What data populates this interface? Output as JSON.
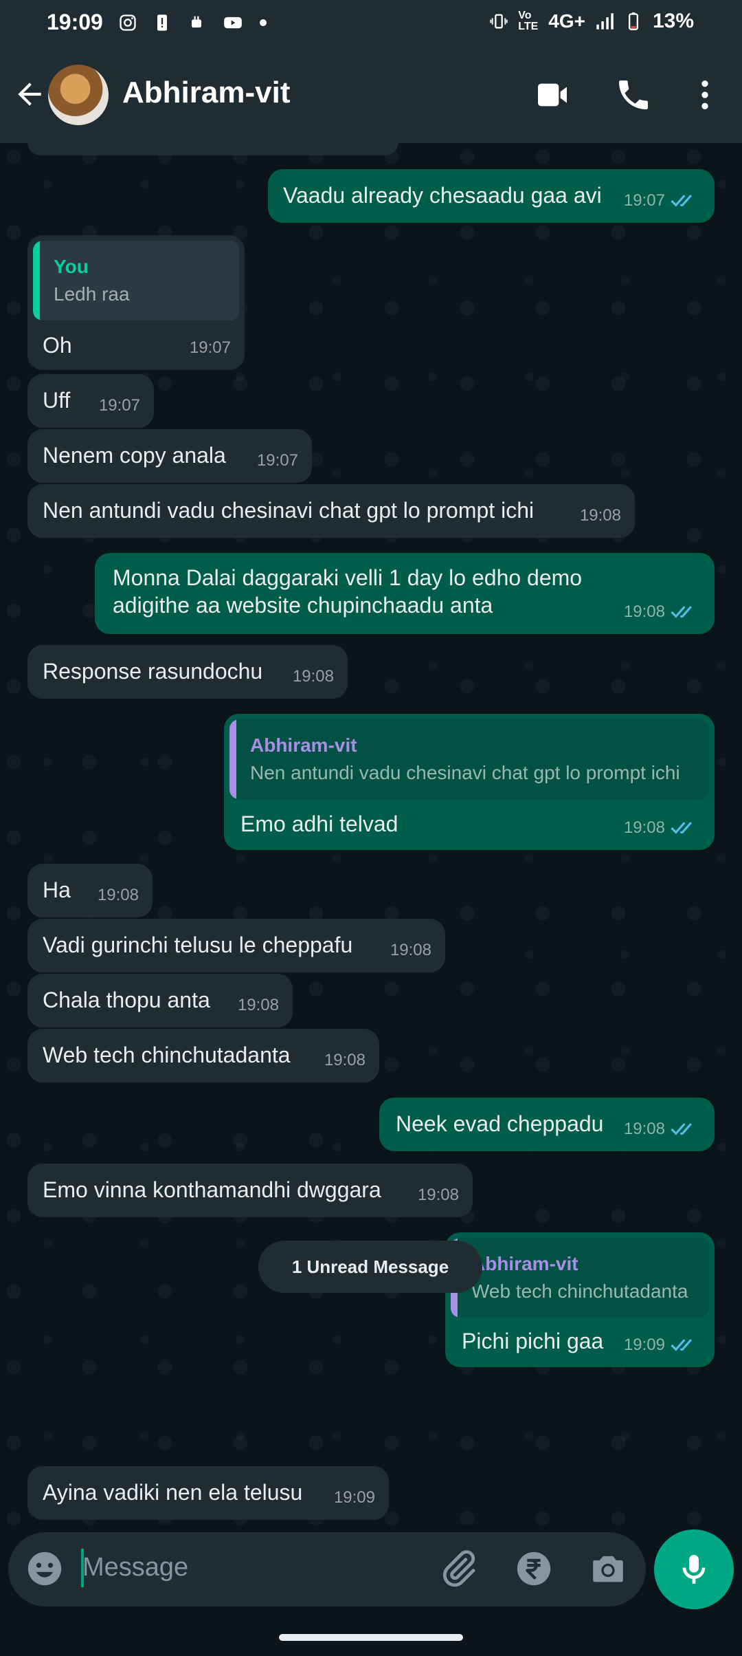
{
  "status_bar": {
    "time": "19:09",
    "network": "4G+",
    "volte": "Vo LTE",
    "battery": "13%"
  },
  "header": {
    "contact_name": "Abhiram-vit"
  },
  "colors": {
    "header_bg": "#1f2c34",
    "incoming_bubble": "#1f2c34",
    "outgoing_bubble": "#005c4b",
    "accent": "#00a884",
    "quote_you": "#06cf9c",
    "quote_contact": "#a98ee6"
  },
  "messages": [
    {
      "dir": "out",
      "text": "Vaadu already chesaadu gaa avi",
      "time": "19:07",
      "read": true
    },
    {
      "dir": "in",
      "quote_author": "You",
      "quote_text": "Ledh raa",
      "text": "Oh",
      "time": "19:07"
    },
    {
      "dir": "in",
      "text": "Uff",
      "time": "19:07"
    },
    {
      "dir": "in",
      "text": "Nenem copy anala",
      "time": "19:07"
    },
    {
      "dir": "in",
      "text": "Nen antundi vadu chesinavi chat gpt lo prompt ichi",
      "time": "19:08"
    },
    {
      "dir": "out",
      "text": "Monna Dalai daggaraki velli 1 day lo edho demo adigithe aa website chupinchaadu anta",
      "time": "19:08",
      "read": true
    },
    {
      "dir": "in",
      "text": "Response rasundochu",
      "time": "19:08"
    },
    {
      "dir": "out",
      "quote_author": "Abhiram-vit",
      "quote_text": "Nen antundi vadu chesinavi chat gpt lo prompt ichi",
      "text": "Emo adhi telvad",
      "time": "19:08",
      "read": true
    },
    {
      "dir": "in",
      "text": "Ha",
      "time": "19:08"
    },
    {
      "dir": "in",
      "text": "Vadi gurinchi telusu le cheppafu",
      "time": "19:08"
    },
    {
      "dir": "in",
      "text": "Chala thopu anta",
      "time": "19:08"
    },
    {
      "dir": "in",
      "text": "Web tech chinchutadanta",
      "time": "19:08"
    },
    {
      "dir": "out",
      "text": "Neek evad cheppadu",
      "time": "19:08",
      "read": true
    },
    {
      "dir": "in",
      "text": "Emo vinna konthamandhi dwggara",
      "time": "19:08"
    },
    {
      "dir": "out",
      "quote_author": "Abhiram-vit",
      "quote_text": "Web tech chinchutadanta",
      "text": "Pichi pichi gaa",
      "time": "19:09",
      "read": true
    }
  ],
  "unread_label": "1 Unread Message",
  "last_message": {
    "dir": "in",
    "text": "Ayina vadiki nen ela telusu",
    "time": "19:09"
  },
  "input": {
    "placeholder": "Message"
  }
}
